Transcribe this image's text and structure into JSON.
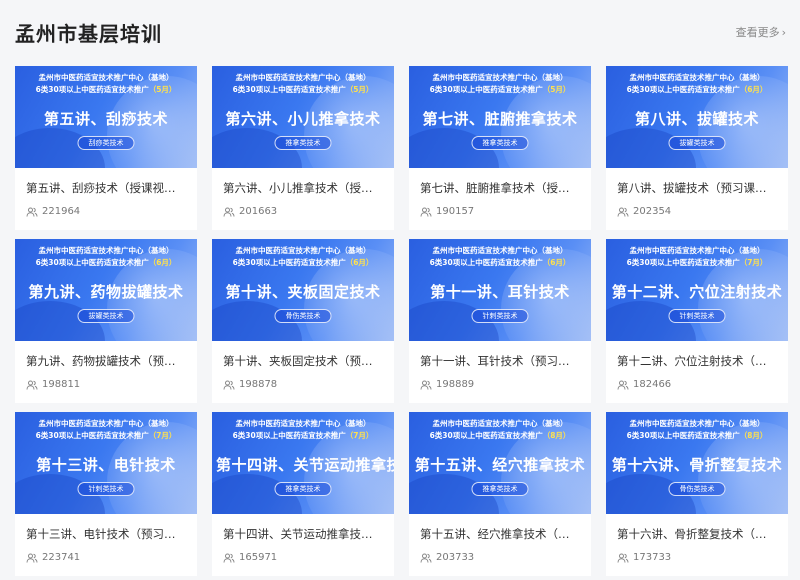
{
  "page": {
    "title": "孟州市基层培训",
    "more_label": "查看更多",
    "more_icon": "chevron-right-icon"
  },
  "banner": {
    "org_line": "孟州市中医药适宜技术推广中心（基地）",
    "sub_line": "6类30项以上中医药适宜技术推广"
  },
  "colors": {
    "banner_blue": "#2a5fe0",
    "month_yellow": "#ffe14d",
    "background": "#f5f6f8"
  },
  "courses": [
    {
      "month": "（5月）",
      "banner_title": "第五讲、刮痧技术",
      "tag": "刮痧类技术",
      "title": "第五讲、刮痧技术（授课视频）",
      "views": "221964"
    },
    {
      "month": "（5月）",
      "banner_title": "第六讲、小儿推拿技术",
      "tag": "推拿类技术",
      "title": "第六讲、小儿推拿技术（授课...",
      "views": "201663"
    },
    {
      "month": "（5月）",
      "banner_title": "第七讲、脏腑推拿技术",
      "tag": "推拿类技术",
      "title": "第七讲、脏腑推拿技术（授课...",
      "views": "190157"
    },
    {
      "month": "（6月）",
      "banner_title": "第八讲、拔罐技术",
      "tag": "拔罐类技术",
      "title": "第八讲、拔罐技术（预习课件）",
      "views": "202354"
    },
    {
      "month": "（6月）",
      "banner_title": "第九讲、药物拔罐技术",
      "tag": "拔罐类技术",
      "title": "第九讲、药物拔罐技术（预习...",
      "views": "198811"
    },
    {
      "month": "（6月）",
      "banner_title": "第十讲、夹板固定技术",
      "tag": "骨伤类技术",
      "title": "第十讲、夹板固定技术（预习...",
      "views": "198878"
    },
    {
      "month": "（6月）",
      "banner_title": "第十一讲、耳针技术",
      "tag": "针刺类技术",
      "title": "第十一讲、耳针技术（预习课...",
      "views": "198889"
    },
    {
      "month": "（7月）",
      "banner_title": "第十二讲、穴位注射技术",
      "tag": "针刺类技术",
      "title": "第十二讲、穴位注射技术（预...",
      "views": "182466"
    },
    {
      "month": "（7月）",
      "banner_title": "第十三讲、电针技术",
      "tag": "针刺类技术",
      "title": "第十三讲、电针技术（预习课...",
      "views": "223741"
    },
    {
      "month": "（7月）",
      "banner_title": "第十四讲、关节运动推拿技术",
      "tag": "推拿类技术",
      "title": "第十四讲、关节运动推拿技术...",
      "views": "165971"
    },
    {
      "month": "（8月）",
      "banner_title": "第十五讲、经穴推拿技术",
      "tag": "推拿类技术",
      "title": "第十五讲、经穴推拿技术（预...",
      "views": "203733"
    },
    {
      "month": "（8月）",
      "banner_title": "第十六讲、骨折整复技术",
      "tag": "骨伤类技术",
      "title": "第十六讲、骨折整复技术（预...",
      "views": "173733"
    }
  ]
}
